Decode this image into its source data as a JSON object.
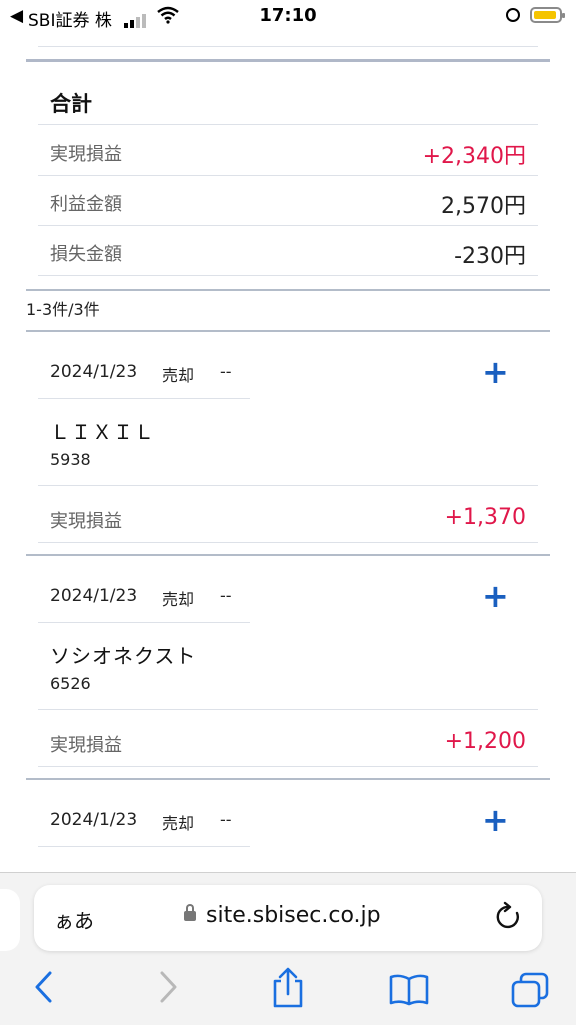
{
  "status_bar": {
    "back_app": "SBI証券 株",
    "time": "17:10"
  },
  "summary": {
    "title": "合計",
    "rows": [
      {
        "label": "実現損益",
        "value": "+2,340円"
      },
      {
        "label": "利益金額",
        "value": "2,570円"
      },
      {
        "label": "損失金額",
        "value": "-230円"
      }
    ]
  },
  "result_count": "1-3件/3件",
  "trades": [
    {
      "date": "2024/1/23",
      "type": "売却",
      "extra": "--",
      "name": "ＬＩＸＩＬ",
      "code": "5938",
      "pl_label": "実現損益",
      "pl_value": "+1,370"
    },
    {
      "date": "2024/1/23",
      "type": "売却",
      "extra": "--",
      "name": "ソシオネクスト",
      "code": "6526",
      "pl_label": "実現損益",
      "pl_value": "+1,200"
    },
    {
      "date": "2024/1/23",
      "type": "売却",
      "extra": "--",
      "name": "",
      "code": "",
      "pl_label": "",
      "pl_value": ""
    }
  ],
  "expand_symbol": "+",
  "browser": {
    "aa_label": "ぁあ",
    "url": "site.sbisec.co.jp"
  },
  "colors": {
    "profit_red": "#e0174a",
    "link_blue": "#1a5fbf",
    "battery_yellow": "#f5c400"
  },
  "icons": [
    "back-arrow-icon",
    "cellular-signal-icon",
    "wifi-icon",
    "orientation-lock-icon",
    "battery-icon",
    "lock-icon",
    "reload-icon",
    "back-icon",
    "forward-icon",
    "share-icon",
    "bookmarks-icon",
    "tabs-icon",
    "plus-icon"
  ]
}
